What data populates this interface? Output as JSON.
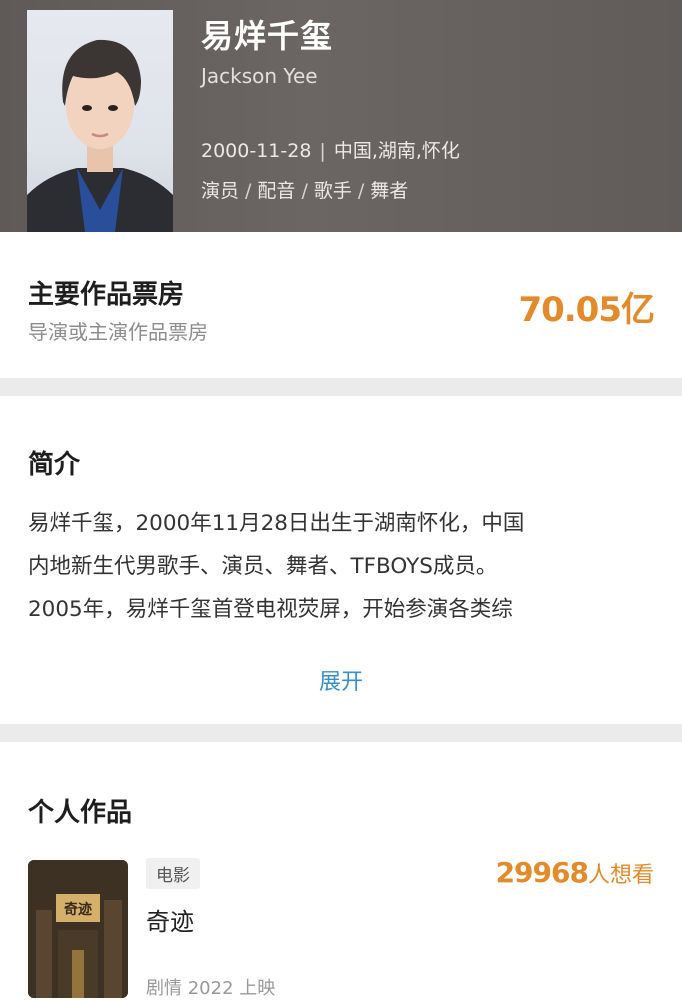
{
  "header": {
    "name": "易烊千玺",
    "english_name": "Jackson Yee",
    "birth_date": "2000-11-28",
    "separator": "|",
    "birthplace": "中国,湖南,怀化",
    "roles": [
      "演员",
      "配音",
      "歌手",
      "舞者"
    ],
    "role_separator": "/"
  },
  "box_office": {
    "title": "主要作品票房",
    "subtitle": "导演或主演作品票房",
    "value": "70.05亿"
  },
  "intro": {
    "title": "简介",
    "lines": [
      "易烊千玺，2000年11月28日出生于湖南怀化，中国",
      "内地新生代男歌手、演员、舞者、TFBOYS成员。",
      "2005年，易烊千玺首登电视荧屏，开始参演各类综"
    ],
    "expand_label": "展开"
  },
  "works": {
    "title": "个人作品",
    "items": [
      {
        "tag": "电影",
        "name": "奇迹",
        "meta": "剧情 2022 上映",
        "want_count": "29968",
        "want_unit": "人想看",
        "poster_text": "奇迹"
      }
    ]
  },
  "colors": {
    "accent_orange": "#e38a2a",
    "link_blue": "#3a8fc4",
    "header_bg": "#645f5d"
  }
}
